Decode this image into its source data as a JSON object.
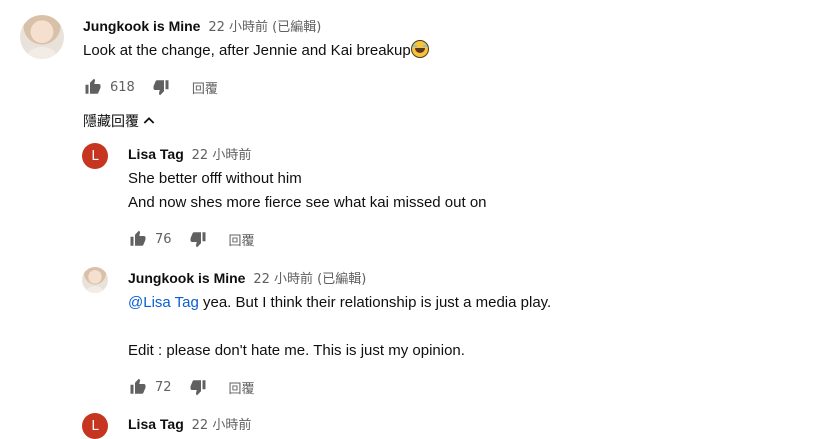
{
  "comments": [
    {
      "author": "Jungkook is Mine",
      "time": "22 小時前 (已編輯)",
      "text": "Look at the change, after Jennie and Kai breakup",
      "emoji": "laughing-tears-emoji",
      "likes": "618",
      "reply_label": "回覆"
    }
  ],
  "hide_replies_label": "隱藏回覆",
  "replies": [
    {
      "author": "Lisa Tag",
      "avatar_letter": "L",
      "time": "22 小時前",
      "lines": [
        "She better offf without him",
        "And now shes more fierce see what kai missed out on"
      ],
      "likes": "76",
      "reply_label": "回覆"
    },
    {
      "author": "Jungkook is Mine",
      "time": "22 小時前 (已編輯)",
      "mention": "@Lisa Tag",
      "line1_rest": " yea. But I think their relationship is just a media play.",
      "line2": "Edit : please don't hate me. This is just my opinion.",
      "likes": "72",
      "reply_label": "回覆"
    },
    {
      "author": "Lisa Tag",
      "avatar_letter": "L",
      "time": "22 小時前"
    }
  ],
  "colors": {
    "avatar_letter_bg": "#c6351f",
    "mention": "#065fd4",
    "secondary_text": "#606060"
  }
}
